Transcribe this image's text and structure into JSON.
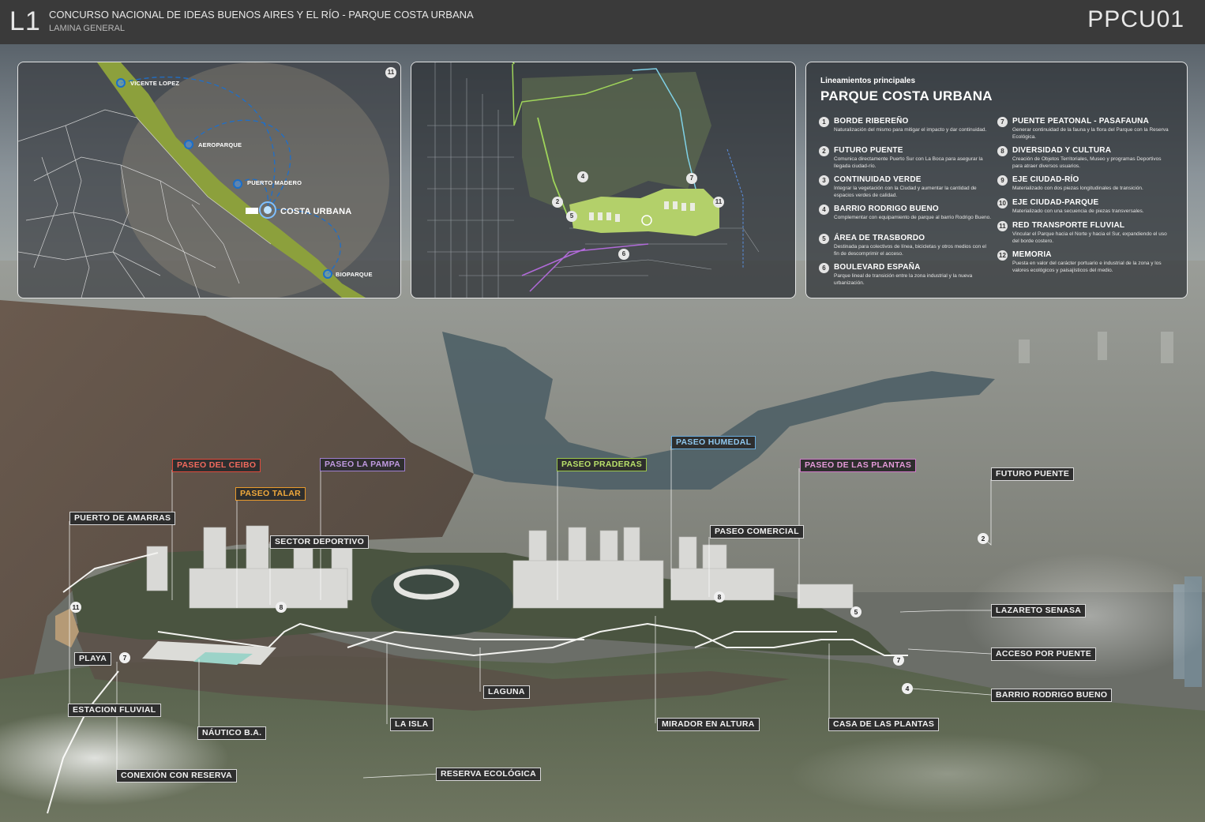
{
  "header": {
    "sheet_number": "L1",
    "title": "CONCURSO NACIONAL DE IDEAS BUENOS AIRES Y EL RÍO - PARQUE COSTA URBANA",
    "subtitle": "LAMINA GENERAL",
    "code": "PPCU01"
  },
  "map_panel": {
    "badge": "11",
    "labels": {
      "vicente_lopez": "VICENTE LOPEZ",
      "aeroparque": "AEROPARQUE",
      "puerto_madero": "PUERTO MADERO",
      "costa_urbana": "COSTA URBANA",
      "bioparque": "BIOPARQUE"
    }
  },
  "plan_panel": {
    "numbers": [
      "2",
      "4",
      "5",
      "6",
      "7",
      "11"
    ]
  },
  "legend": {
    "kicker": "Lineamientos principales",
    "title": "PARQUE COSTA URBANA",
    "items": [
      {
        "num": "1",
        "head": "BORDE RIBEREÑO",
        "desc": "Naturalización del mismo para mitigar el impacto y dar continuidad."
      },
      {
        "num": "2",
        "head": "FUTURO PUENTE",
        "desc": "Comunica directamente Puerto Sur con La Boca para asegurar la llegada ciudad-río."
      },
      {
        "num": "3",
        "head": "CONTINUIDAD VERDE",
        "desc": "Integrar la vegetación con la Ciudad y aumentar la cantidad de espacios verdes de calidad."
      },
      {
        "num": "4",
        "head": "BARRIO RODRIGO BUENO",
        "desc": "Complementar con equipamiento de parque al barrio Rodrigo Bueno."
      },
      {
        "num": "5",
        "head": "ÁREA DE TRASBORDO",
        "desc": "Destinada para colectivos de línea, bicicletas y otros medios con el fin de descomprimir el acceso."
      },
      {
        "num": "6",
        "head": "BOULEVARD ESPAÑA",
        "desc": "Parque lineal de transición entre la zona industrial y la nueva urbanización."
      },
      {
        "num": "7",
        "head": "PUENTE PEATONAL - PASAFAUNA",
        "desc": "Generar continuidad de la fauna y la flora del Parque con la Reserva Ecológica."
      },
      {
        "num": "8",
        "head": "DIVERSIDAD Y CULTURA",
        "desc": "Creación de Objetos Territoriales, Museo y programas Deportivos para atraer diversos usuarios."
      },
      {
        "num": "9",
        "head": "EJE CIUDAD-RÍO",
        "desc": "Materializado con dos piezas longitudinales de transición."
      },
      {
        "num": "10",
        "head": "EJE CIUDAD-PARQUE",
        "desc": "Materializado con una secuencia de piezas transversales."
      },
      {
        "num": "11",
        "head": "RED TRANSPORTE FLUVIAL",
        "desc": "Vincular el Parque hacia el Norte y hacia el Sur, expandiendo el uso del borde costero."
      },
      {
        "num": "12",
        "head": "MEMORIA",
        "desc": "Puesta en valor del carácter portuario e industrial de la zona y los valores ecológicos y paisajísticos del medio."
      }
    ]
  },
  "site_labels": {
    "paseo_del_ceibo": "PASEO DEL CEIBO",
    "paseo_talar": "PASEO TALAR",
    "paseo_la_pampa": "PASEO LA PAMPA",
    "paseo_praderas": "PASEO PRADERAS",
    "paseo_humedal": "PASEO HUMEDAL",
    "paseo_de_las_plantas": "PASEO DE LAS PLANTAS",
    "futuro_puente": "FUTURO PUENTE",
    "puerto_de_amarras": "PUERTO DE AMARRAS",
    "sector_deportivo": "SECTOR DEPORTIVO",
    "paseo_comercial": "PASEO COMERCIAL",
    "lazareto_senasa": "LAZARETO SENASA",
    "acceso_por_puente": "ACCESO POR PUENTE",
    "barrio_rodrigo_bueno": "BARRIO RODRIGO BUENO",
    "playa": "PLAYA",
    "estacion_fluvial": "ESTACION FLUVIAL",
    "nautico_ba": "NÁUTICO B.A.",
    "conexion_con_reserva": "CONEXIÓN CON RESERVA",
    "la_isla": "LA ISLA",
    "laguna": "LAGUNA",
    "reserva_ecologica": "RESERVA ECOLÓGICA",
    "mirador_en_altura": "MIRADOR EN ALTURA",
    "casa_de_las_plantas": "CASA DE LAS PLANTAS"
  },
  "site_numbers": {
    "n11": "11",
    "n7a": "7",
    "n8a": "8",
    "n8b": "8",
    "n2": "2",
    "n5": "5",
    "n7b": "7",
    "n4": "4"
  }
}
